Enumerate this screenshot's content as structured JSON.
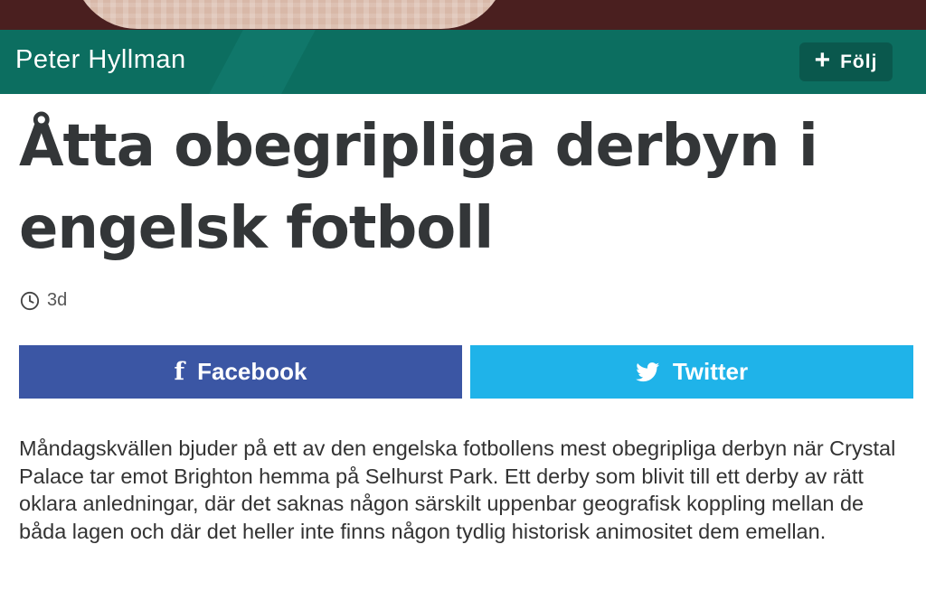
{
  "author": {
    "name": "Peter Hyllman",
    "follow_label": "Följ"
  },
  "article": {
    "title": "Åtta obegripliga derbyn i engelsk fotboll",
    "age": "3d",
    "body": "Måndagskvällen bjuder på ett av den engelska fotbollens mest obegripliga derbyn när Crystal Palace tar emot Brighton hemma på Selhurst Park. Ett derby som blivit till ett derby av rätt oklara anledningar, där det saknas någon särskilt uppenbar geografisk koppling mellan de båda lagen och där det heller inte finns någon tydlig historisk animositet dem emellan."
  },
  "share": {
    "facebook_label": "Facebook",
    "twitter_label": "Twitter"
  },
  "icons": {
    "follow": "plus-icon",
    "age": "clock-icon",
    "facebook": "facebook-icon",
    "twitter": "twitter-bird-icon"
  },
  "colors": {
    "author_bar": "#0c6e60",
    "follow_button": "#0a584d",
    "facebook": "#3b56a4",
    "twitter": "#1fb3e9"
  }
}
